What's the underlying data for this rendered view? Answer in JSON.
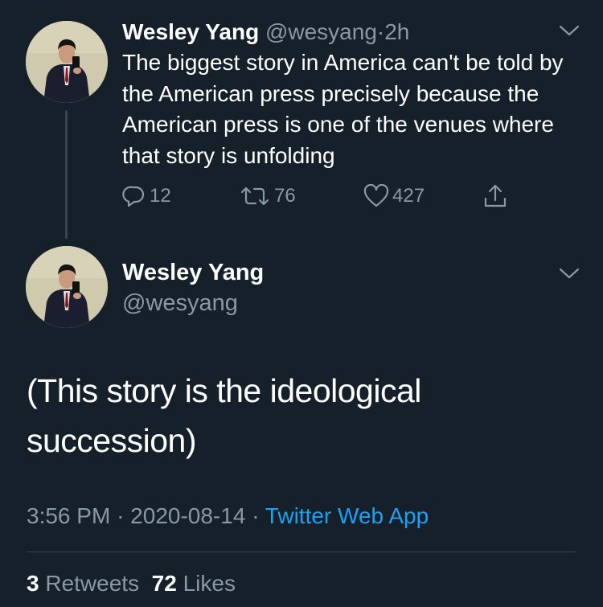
{
  "tweet1": {
    "name": "Wesley Yang",
    "handle": "@wesyang",
    "separator": "·",
    "time": "2h",
    "text": "The biggest story in America can't be told by the American press precisely because the American press is one of the venues where that story is unfolding",
    "replies": "12",
    "retweets": "76",
    "likes": "427",
    "icons": [
      "reply-icon",
      "retweet-icon",
      "like-icon",
      "share-icon",
      "chevron-down-icon"
    ]
  },
  "tweet2": {
    "name": "Wesley Yang",
    "handle": "@wesyang",
    "text": "(This story is the ideological succession)",
    "time": "3:56 PM",
    "sep1": "·",
    "date": "2020-08-14",
    "sep2": "·",
    "app": "Twitter Web App",
    "retweet_count": "3",
    "retweet_label": "Retweets",
    "like_count": "72",
    "like_label": "Likes"
  },
  "colors": {
    "background": "#15202b",
    "muted": "#8899a6",
    "accent": "#1da1f2",
    "divider": "#38444d"
  }
}
